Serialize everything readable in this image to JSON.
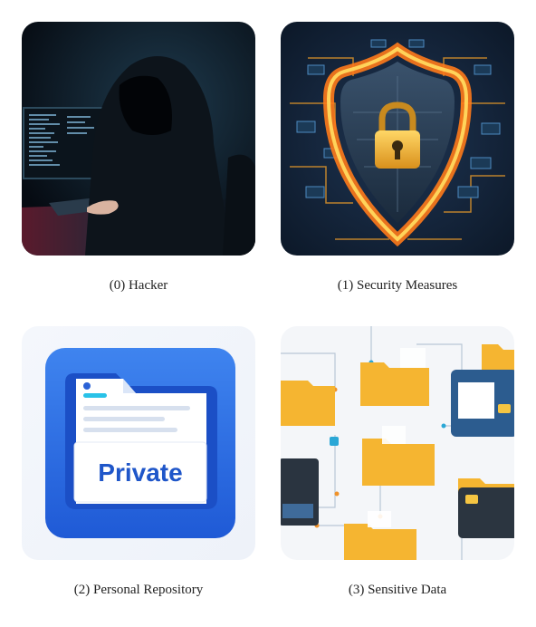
{
  "options": [
    {
      "caption": "(0) Hacker",
      "icon": "hacker-image"
    },
    {
      "caption": "(1) Security Measures",
      "icon": "shield-lock-image"
    },
    {
      "caption": "(2) Personal Repository",
      "icon": "private-folder-image",
      "badge_text": "Private"
    },
    {
      "caption": "(3) Sensitive Data",
      "icon": "data-folders-image"
    }
  ],
  "colors": {
    "hacker_bg": "#0c1722",
    "shield_bg": "#14253d",
    "flame": "#ff8a1e",
    "lock": "#f3b52d",
    "folder_blue": "#2f6fe6",
    "folder_yellow": "#f5b531"
  }
}
